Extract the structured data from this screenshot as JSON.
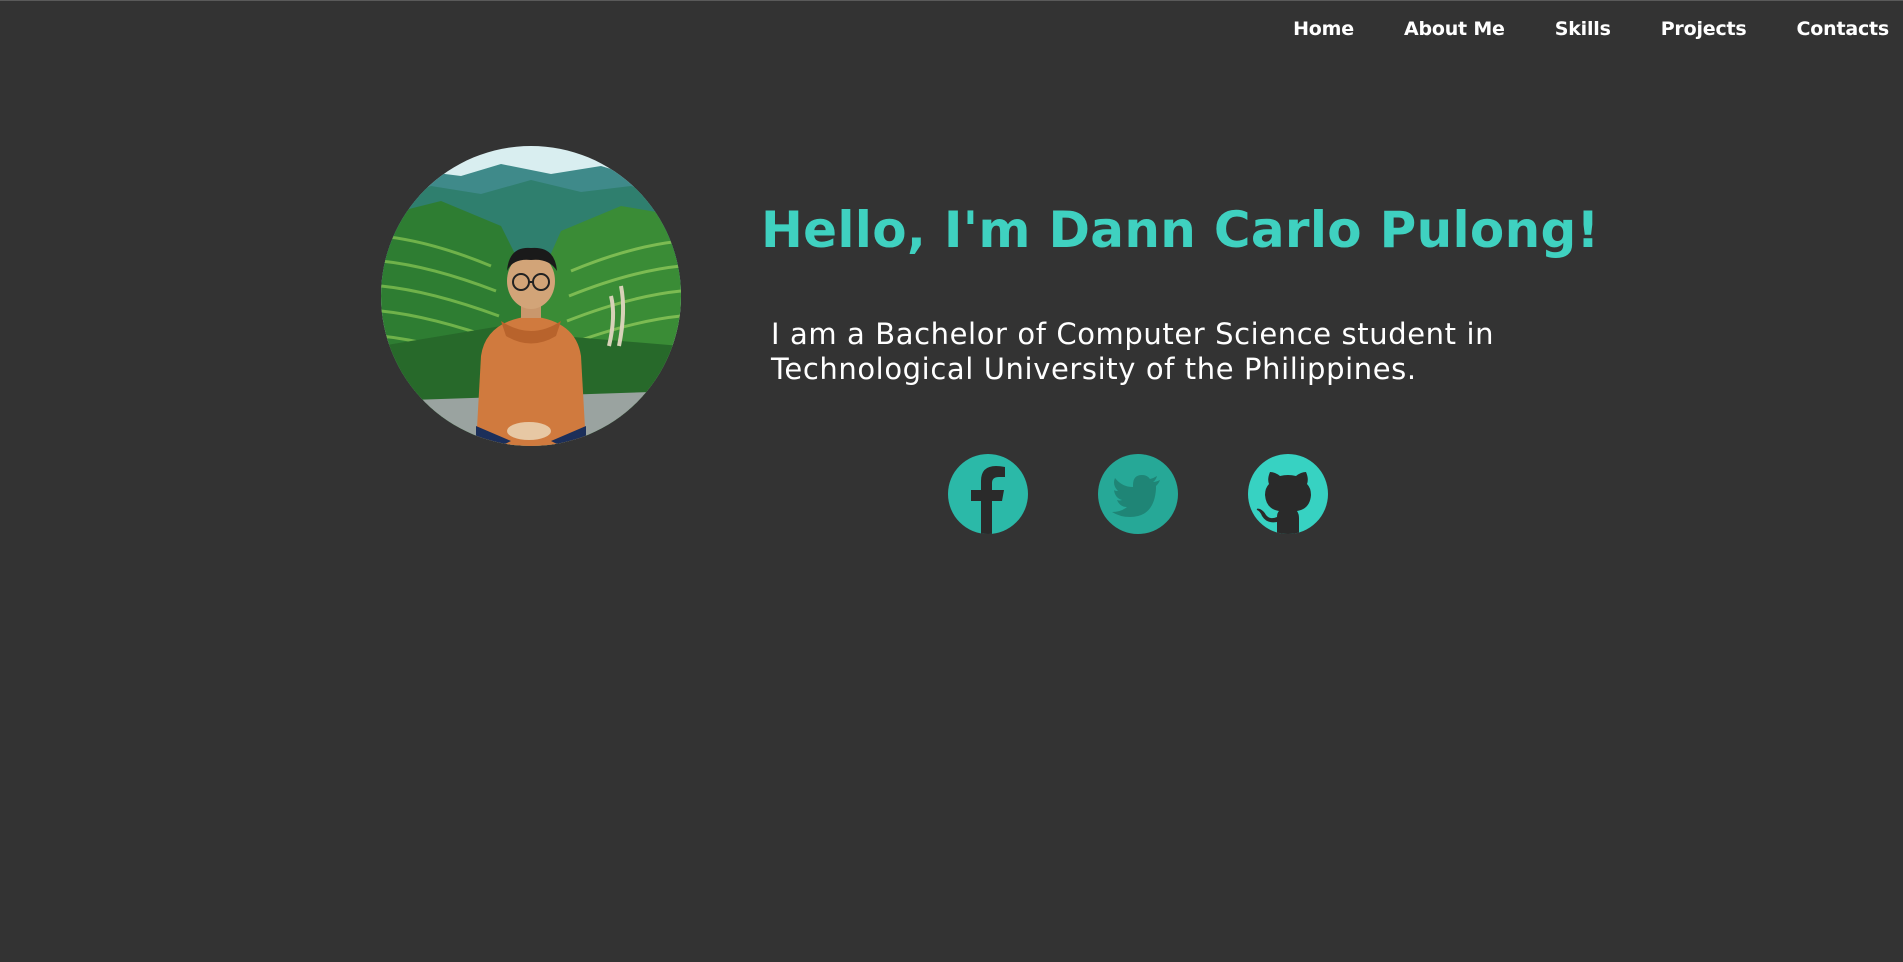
{
  "nav": {
    "items": [
      {
        "label": "Home"
      },
      {
        "label": "About Me"
      },
      {
        "label": "Skills"
      },
      {
        "label": "Projects"
      },
      {
        "label": "Contacts"
      }
    ]
  },
  "hero": {
    "title": "Hello, I'm Dann Carlo Pulong!",
    "description": "I am a Bachelor of Computer Science student in Technological University of the Philippines."
  },
  "social": [
    {
      "icon": "facebook-icon"
    },
    {
      "icon": "twitter-icon"
    },
    {
      "icon": "github-icon"
    }
  ],
  "colors": {
    "background": "#333333",
    "accent": "#3fd1c0",
    "text": "#ffffff"
  }
}
